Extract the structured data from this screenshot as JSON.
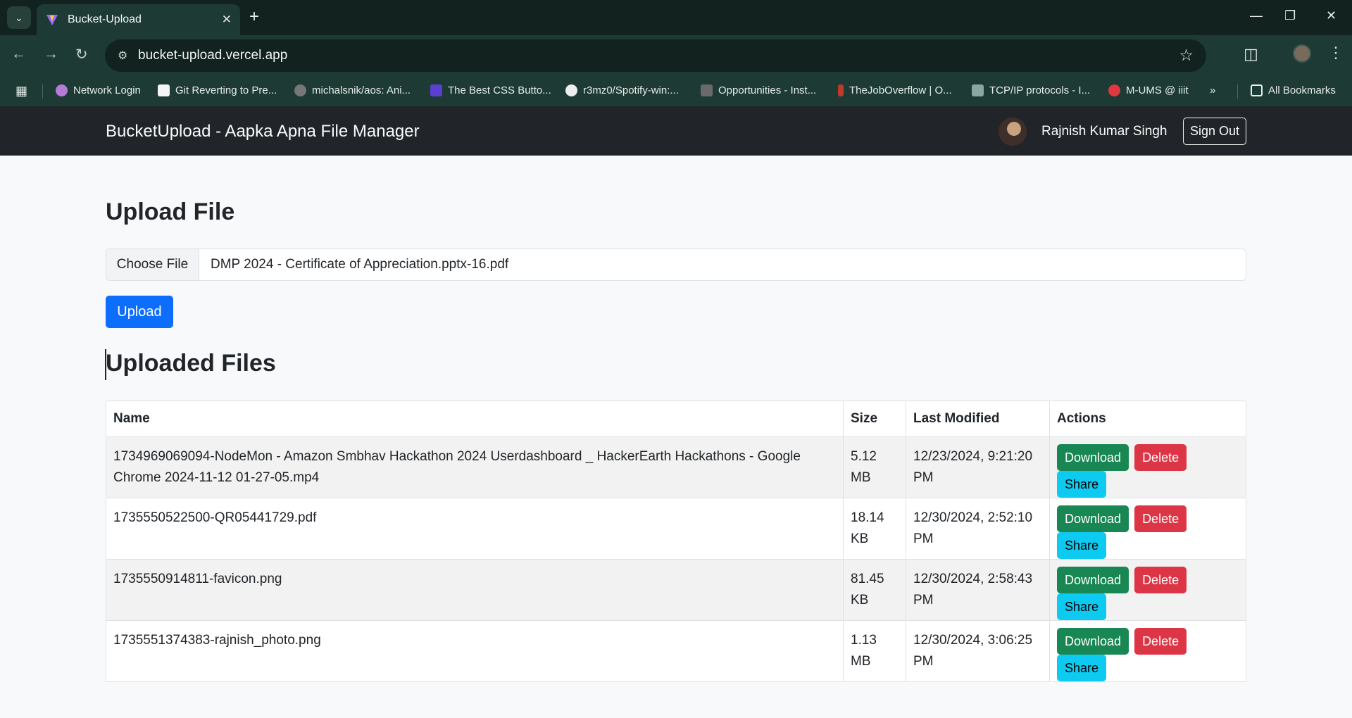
{
  "browser": {
    "tab_title": "Bucket-Upload",
    "url": "bucket-upload.vercel.app",
    "bookmarks": [
      {
        "label": "Network Login",
        "color": "#b57bd6"
      },
      {
        "label": "Git Reverting to Pre...",
        "color": "#f5f5f5"
      },
      {
        "label": "michalsnik/aos: Ani...",
        "color": "#777777"
      },
      {
        "label": "The Best CSS Butto...",
        "color": "#5b3fd1"
      },
      {
        "label": "r3mz0/Spotify-win:...",
        "color": "#eeeeee"
      },
      {
        "label": "Opportunities - Inst...",
        "color": "#6a6a6a"
      },
      {
        "label": "TheJobOverflow | O...",
        "color": "#c0392b"
      },
      {
        "label": "TCP/IP protocols - I...",
        "color": "#8aa7a0"
      },
      {
        "label": "M-UMS @ iiit",
        "color": "#e0383e"
      }
    ],
    "all_bookmarks": "All Bookmarks"
  },
  "navbar": {
    "brand": "BucketUpload - Aapka Apna File Manager",
    "user_name": "Rajnish Kumar Singh",
    "sign_out": "Sign Out"
  },
  "upload": {
    "heading": "Upload File",
    "choose_label": "Choose File",
    "selected_file": "DMP 2024 - Certificate of Appreciation.pptx-16.pdf",
    "upload_button": "Upload"
  },
  "files": {
    "heading": "Uploaded Files",
    "columns": [
      "Name",
      "Size",
      "Last Modified",
      "Actions"
    ],
    "rows": [
      {
        "name": "1734969069094-NodeMon - Amazon Smbhav Hackathon 2024 Userdashboard _ HackerEarth Hackathons - Google Chrome 2024-11-12 01-27-05.mp4",
        "size": "5.12 MB",
        "modified": "12/23/2024, 9:21:20 PM"
      },
      {
        "name": "1735550522500-QR05441729.pdf",
        "size": "18.14 KB",
        "modified": "12/30/2024, 2:52:10 PM"
      },
      {
        "name": "1735550914811-favicon.png",
        "size": "81.45 KB",
        "modified": "12/30/2024, 2:58:43 PM"
      },
      {
        "name": "1735551374383-rajnish_photo.png",
        "size": "1.13 MB",
        "modified": "12/30/2024, 3:06:25 PM"
      }
    ],
    "actions": {
      "download": "Download",
      "delete": "Delete",
      "share": "Share"
    }
  }
}
